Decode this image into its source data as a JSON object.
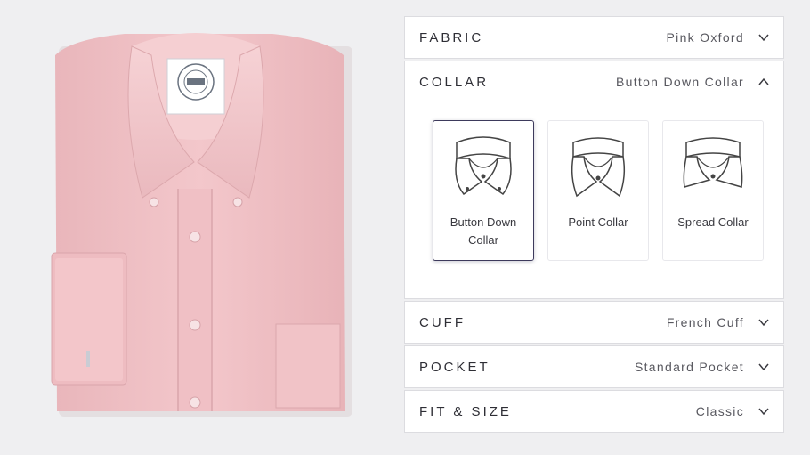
{
  "accordion": {
    "fabric": {
      "title": "FABRIC",
      "value": "Pink Oxford"
    },
    "collar": {
      "title": "COLLAR",
      "value": "Button Down Collar",
      "options": [
        {
          "label": "Button Down Collar",
          "selected": true
        },
        {
          "label": "Point Collar",
          "selected": false
        },
        {
          "label": "Spread Collar",
          "selected": false
        }
      ]
    },
    "cuff": {
      "title": "CUFF",
      "value": "French Cuff"
    },
    "pocket": {
      "title": "POCKET",
      "value": "Standard Pocket"
    },
    "fit": {
      "title": "FIT & SIZE",
      "value": "Classic"
    }
  },
  "colors": {
    "shirt": "#f2c4c8",
    "selected_border": "#3d3a5c",
    "background": "#efeff1"
  }
}
